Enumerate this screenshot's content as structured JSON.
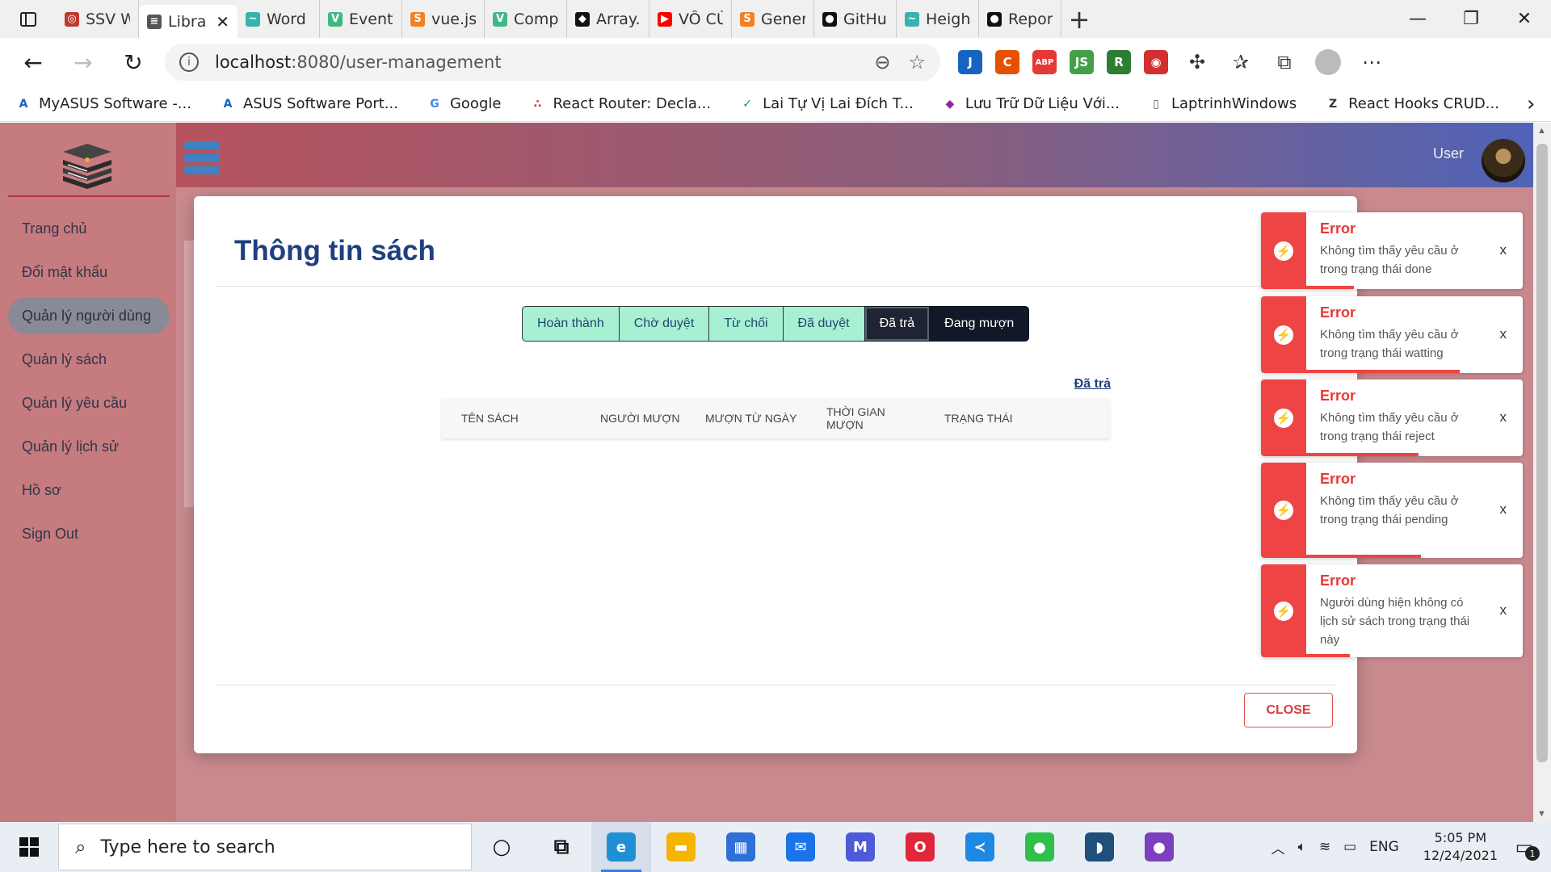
{
  "browser": {
    "tabs": [
      {
        "label": "SSV Web",
        "color": "#c0392b",
        "glyph": "◎"
      },
      {
        "label": "Libra",
        "color": "#555555",
        "glyph": "≡",
        "active": true
      },
      {
        "label": "Word Bre",
        "color": "#38b2ac",
        "glyph": "~"
      },
      {
        "label": "Event Ha",
        "color": "#41b883",
        "glyph": "V"
      },
      {
        "label": "vue.js - a",
        "color": "#f48024",
        "glyph": "S"
      },
      {
        "label": "Compute",
        "color": "#41b883",
        "glyph": "V"
      },
      {
        "label": "Array.pro",
        "color": "#111111",
        "glyph": "◆"
      },
      {
        "label": "VÔ CÙNG",
        "color": "#ff0000",
        "glyph": "▶"
      },
      {
        "label": "Generate",
        "color": "#f48024",
        "glyph": "S"
      },
      {
        "label": "GitHub",
        "color": "#111111",
        "glyph": "●"
      },
      {
        "label": "Height -",
        "color": "#38b2ac",
        "glyph": "~"
      },
      {
        "label": "ReportW",
        "color": "#111111",
        "glyph": "●"
      }
    ],
    "url_host": "localhost",
    "url_path": ":8080/user-management",
    "bookmarks": [
      {
        "label": "MyASUS Software -...",
        "color": "#1565c0",
        "glyph": "A"
      },
      {
        "label": "ASUS Software Port...",
        "color": "#1565c0",
        "glyph": "A"
      },
      {
        "label": "Google",
        "color": "#4285f4",
        "glyph": "G"
      },
      {
        "label": "React Router: Decla...",
        "color": "#d32f2f",
        "glyph": "∴"
      },
      {
        "label": "Lai Tự Vị Lai Đích T...",
        "color": "#009688",
        "glyph": "✓"
      },
      {
        "label": "Lưu Trữ Dữ Liệu Với...",
        "color": "#8e24aa",
        "glyph": "◆"
      },
      {
        "label": "LaptrinhWindows",
        "color": "#555555",
        "glyph": "▯"
      },
      {
        "label": "React Hooks CRUD...",
        "color": "#333333",
        "glyph": "Z"
      }
    ],
    "extensions": [
      {
        "name": "ext-1",
        "color": "#1565c0",
        "glyph": "J"
      },
      {
        "name": "ext-2",
        "color": "#e65100",
        "glyph": "C"
      },
      {
        "name": "abp-extension",
        "color": "#e53935",
        "glyph": "ABP"
      },
      {
        "name": "ext-js",
        "color": "#43a047",
        "glyph": "JS"
      },
      {
        "name": "ext-r",
        "color": "#2e7d32",
        "glyph": "R"
      },
      {
        "name": "ext-red",
        "color": "#d32f2f",
        "glyph": "◉"
      }
    ]
  },
  "app": {
    "menu": [
      {
        "label": "Trang chủ"
      },
      {
        "label": "Đổi mật khẩu"
      },
      {
        "label": "Quản lý người dùng",
        "active": true
      },
      {
        "label": "Quản lý sách"
      },
      {
        "label": "Quản lý yêu cầu"
      },
      {
        "label": "Quản lý lịch sử"
      },
      {
        "label": "Hồ sơ"
      },
      {
        "label": "Sign Out"
      }
    ],
    "user_label": "User"
  },
  "modal": {
    "title": "Thông tin sách",
    "status_buttons": [
      {
        "label": "Hoàn thành",
        "style": "green"
      },
      {
        "label": "Chờ duyệt",
        "style": "green"
      },
      {
        "label": "Từ chối",
        "style": "green"
      },
      {
        "label": "Đã duyệt",
        "style": "green"
      },
      {
        "label": "Đã trả",
        "style": "dark",
        "selected": true
      },
      {
        "label": "Đang mượn",
        "style": "dark"
      }
    ],
    "filter_label": "Đã trả",
    "columns": [
      "TÊN SÁCH",
      "NGƯỜI MƯỢN",
      "MƯỢN TỪ NGÀY",
      "THỜI GIAN MƯỢN",
      "TRẠNG THÁI"
    ],
    "close_label": "CLOSE"
  },
  "toasts": [
    {
      "title": "Error",
      "message": "Không tìm thấy yêu cầu ở trong trạng thái done",
      "close": "x",
      "progress": 0.22
    },
    {
      "title": "Error",
      "message": "Không tìm thấy yêu cầu ở trong trạng thái watting",
      "close": "x",
      "progress": 0.71
    },
    {
      "title": "Error",
      "message": "Không tìm thấy yêu cầu ở trong trạng thái reject",
      "close": "x",
      "progress": 0.52
    },
    {
      "title": "Error",
      "message": "Không tìm thấy yêu cầu ở trong trạng thái pending",
      "close": "x",
      "progress": 0.53
    },
    {
      "title": "Error",
      "message": "Người dùng hiện không có lịch sử sách trong trạng thái này",
      "close": "x",
      "progress": 0.2
    }
  ],
  "taskbar": {
    "search_placeholder": "Type here to search",
    "apps": [
      {
        "name": "cortana",
        "color": "transparent",
        "glyph": "○",
        "text_color": "#111111"
      },
      {
        "name": "task-view",
        "color": "transparent",
        "glyph": "⧉",
        "text_color": "#111111"
      },
      {
        "name": "edge",
        "color": "#1f8fd6",
        "glyph": "e",
        "active": true
      },
      {
        "name": "file-explorer",
        "color": "#f4b400",
        "glyph": "▬"
      },
      {
        "name": "store",
        "color": "#2f6fd6",
        "glyph": "▦"
      },
      {
        "name": "mail",
        "color": "#1a73e8",
        "glyph": "✉"
      },
      {
        "name": "app-m",
        "color": "#4e5ad8",
        "glyph": "M"
      },
      {
        "name": "opera",
        "color": "#e0263a",
        "glyph": "O"
      },
      {
        "name": "vscode",
        "color": "#1e88e5",
        "glyph": "≺"
      },
      {
        "name": "line",
        "color": "#2ec04a",
        "glyph": "●"
      },
      {
        "name": "mysql",
        "color": "#1f4f7a",
        "glyph": "◗"
      },
      {
        "name": "github-desktop",
        "color": "#7b3fbf",
        "glyph": "●"
      }
    ],
    "lang": "ENG",
    "time": "5:05 PM",
    "date": "12/24/2021",
    "notif_count": "1"
  }
}
